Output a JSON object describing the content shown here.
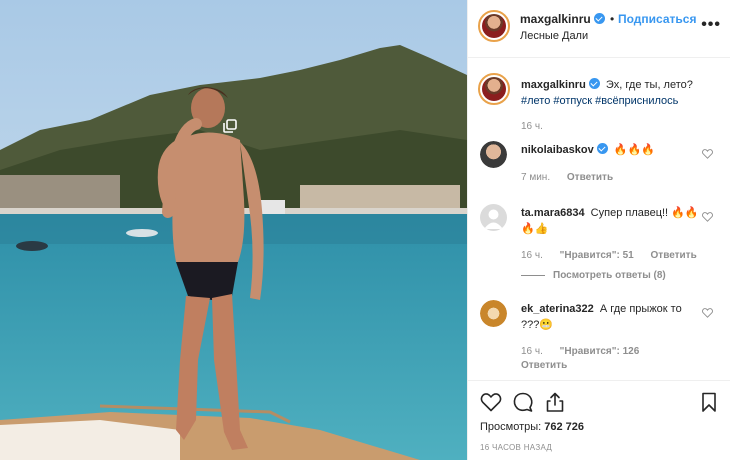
{
  "post": {
    "author": "maxgalkinru",
    "follow_label": "Подписаться",
    "dot": "•",
    "location": "Лесные Дали",
    "more_icon": "more-dots-icon"
  },
  "caption": {
    "author": "maxgalkinru",
    "text": "Эх, где ты, лето?",
    "hashtags": "#лето #отпуск #всёприснилось",
    "time": "16 ч."
  },
  "comments": [
    {
      "author": "nikolaibaskov",
      "verified": true,
      "text": "🔥🔥🔥",
      "time": "7 мин.",
      "likes": "",
      "reply_label": "Ответить"
    },
    {
      "author": "ta.mara6834",
      "verified": false,
      "text": "Супер плавец!! 🔥🔥🔥👍",
      "time": "16 ч.",
      "likes": "\"Нравится\": 51",
      "reply_label": "Ответить",
      "view_replies": "Посмотреть ответы (8)"
    },
    {
      "author": "ek_aterina322",
      "verified": false,
      "text": "А где прыжок то ???😬",
      "time": "16 ч.",
      "likes": "\"Нравится\": 126",
      "reply_label": "Ответить"
    }
  ],
  "footer": {
    "views_label": "Просмотры:",
    "views_count": "762 726",
    "timestamp": "16 ЧАСОВ НАЗАД"
  },
  "colors": {
    "link": "#3897f0",
    "hashtag": "#003569",
    "muted": "#8e8e8e"
  }
}
